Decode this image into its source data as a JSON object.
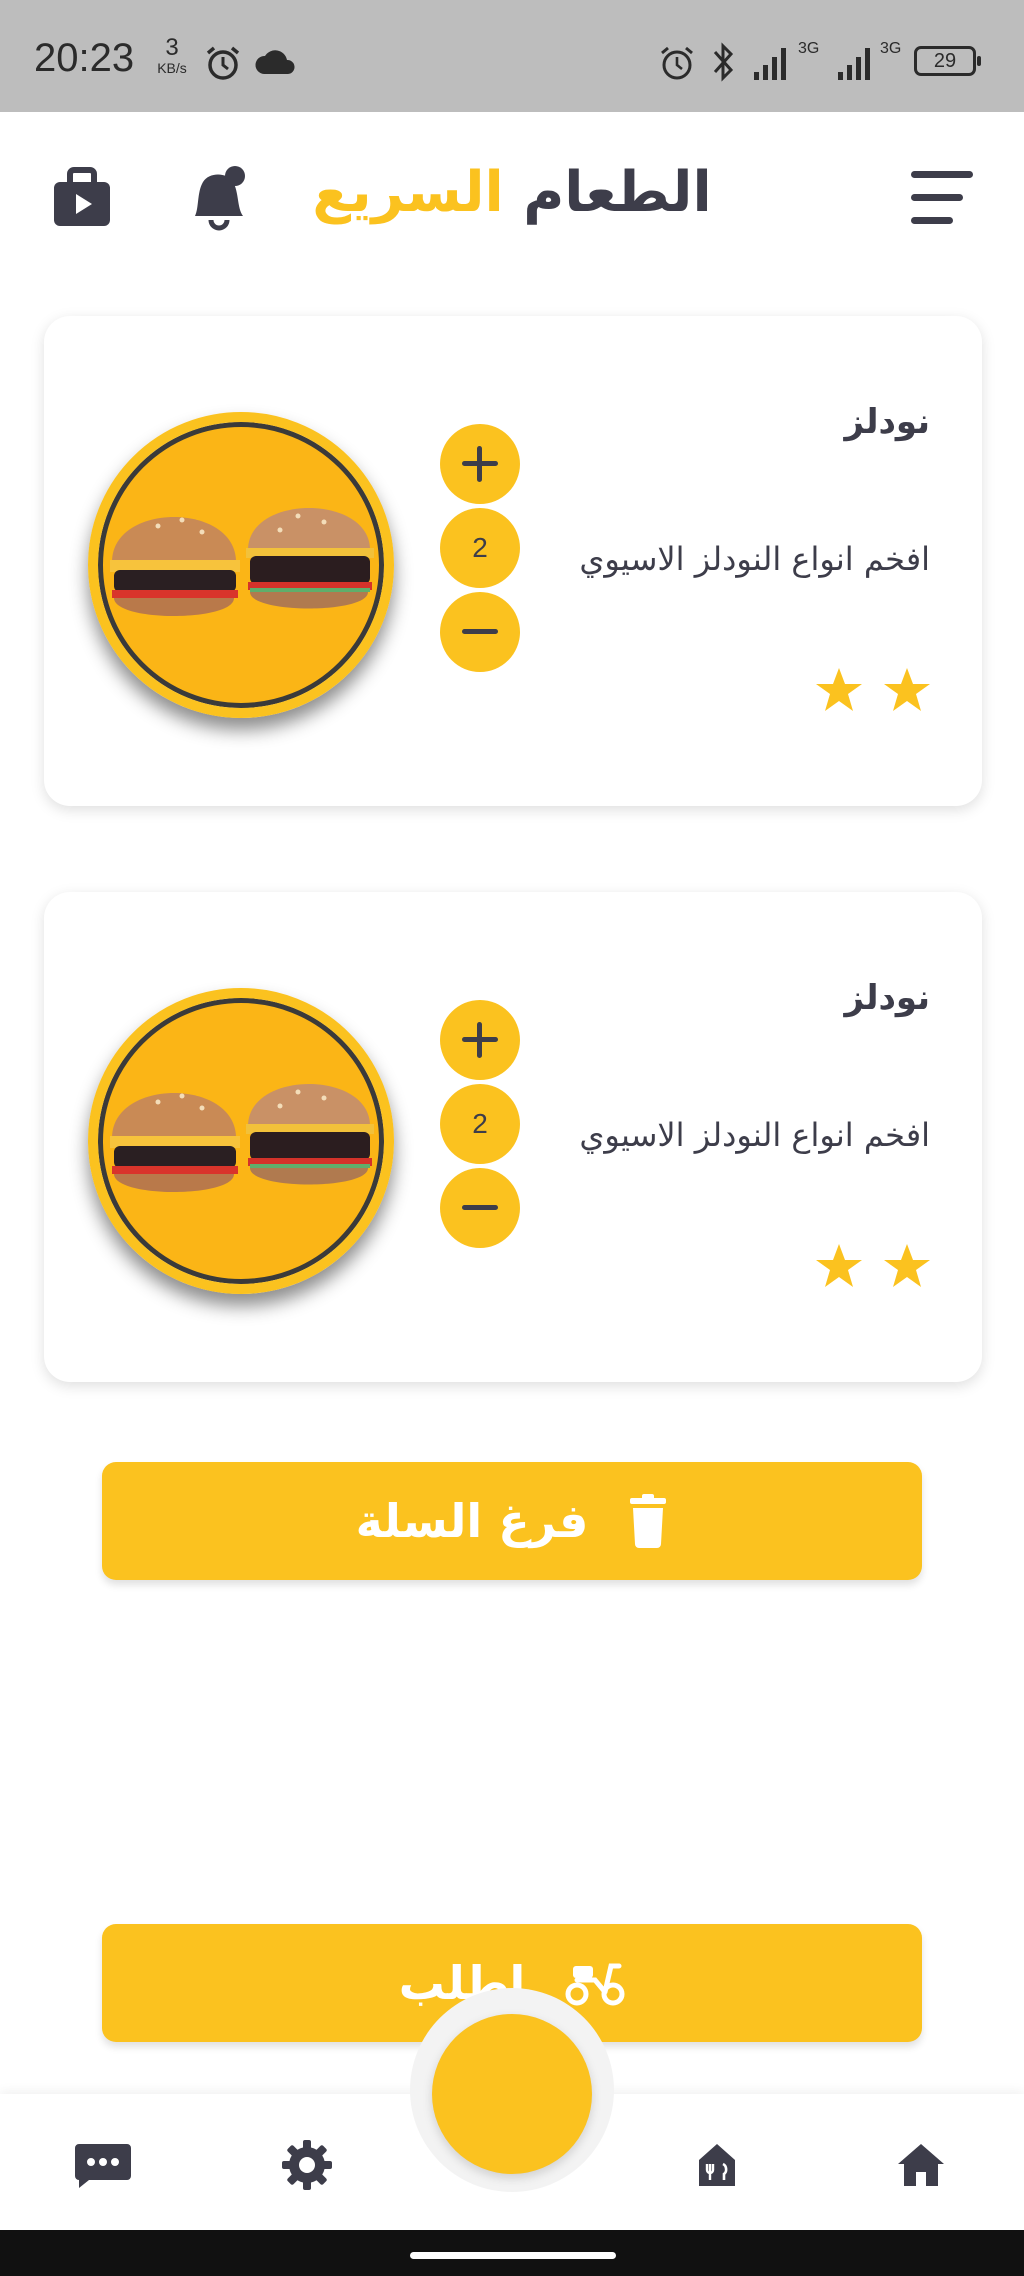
{
  "status_bar": {
    "time": "20:23",
    "speed_value": "3",
    "speed_unit": "KB/s",
    "net_1": "3G",
    "net_2": "3G",
    "battery": "29"
  },
  "header": {
    "title_dark": "الطعام",
    "title_accent": "السريع",
    "menu_icon": "menu-icon",
    "bell_icon": "bell-icon",
    "bag_icon": "bag-icon"
  },
  "cart_items": [
    {
      "name": "نودلز",
      "description": "افخم انواع النودلز الاسيوي",
      "quantity": "2",
      "rating": 2
    },
    {
      "name": "نودلز",
      "description": "افخم انواع النودلز الاسيوي",
      "quantity": "2",
      "rating": 2
    }
  ],
  "actions": {
    "clear_cart_label": "فرغ السلة",
    "order_label": "اطلب"
  },
  "bottom_nav": {
    "items": [
      "chat-icon",
      "gear-icon",
      "restaurant-icon",
      "home-icon"
    ]
  },
  "colors": {
    "accent": "#fbc21f",
    "text": "#3d3d4a",
    "status_bar": "#bdbdbd"
  }
}
